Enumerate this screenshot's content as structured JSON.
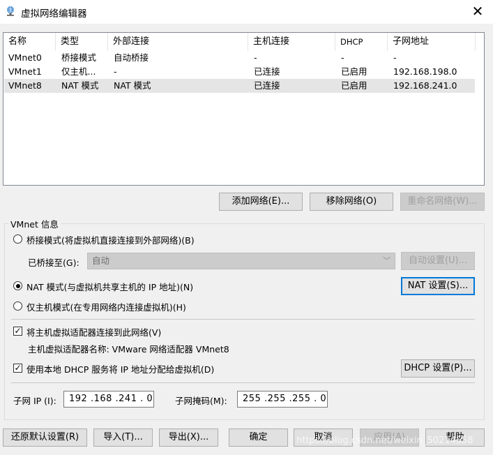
{
  "window": {
    "title": "虚拟网络编辑器",
    "close": "✕"
  },
  "table": {
    "headers": [
      "名称",
      "类型",
      "外部连接",
      "主机连接",
      "DHCP",
      "子网地址"
    ],
    "rows": [
      [
        "VMnet0",
        "桥接模式",
        "自动桥接",
        "-",
        "-",
        "-"
      ],
      [
        "VMnet1",
        "仅主机...",
        "-",
        "已连接",
        "已启用",
        "192.168.198.0"
      ],
      [
        "VMnet8",
        "NAT 模式",
        "NAT 模式",
        "已连接",
        "已启用",
        "192.168.241.0"
      ]
    ],
    "selected_row": 2
  },
  "net_buttons": {
    "add": "添加网络(E)...",
    "remove": "移除网络(O)",
    "rename": "重命名网络(W)..."
  },
  "info": {
    "group_title": "VMnet 信息",
    "bridged_label": "桥接模式(将虚拟机直接连接到外部网络)(B)",
    "bridged_to_label": "已桥接至(G):",
    "bridged_to_value": "自动",
    "auto_settings": "自动设置(U)...",
    "nat_label": "NAT 模式(与虚拟机共享主机的 IP 地址)(N)",
    "nat_settings": "NAT 设置(S)...",
    "hostonly_label": "仅主机模式(在专用网络内连接虚拟机)(H)",
    "connect_adapter_label": "将主机虚拟适配器连接到此网络(V)",
    "adapter_name": "主机虚拟适配器名称: VMware 网络适配器 VMnet8",
    "dhcp_label": "使用本地 DHCP 服务将 IP 地址分配给虚拟机(D)",
    "dhcp_settings": "DHCP 设置(P)...",
    "subnet_ip_label": "子网 IP (I):",
    "subnet_ip": "192 .168 .241 .  0",
    "subnet_mask_label": "子网掩码(M):",
    "subnet_mask": "255 .255 .255 .  0",
    "selected_mode": "nat",
    "connect_adapter_checked": true,
    "dhcp_checked": true,
    "check_mark": "✓"
  },
  "bottom_buttons": {
    "restore": "还原默认设置(R)",
    "import": "导入(T)...",
    "export": "导出(X)...",
    "ok": "确定",
    "cancel": "取消",
    "apply": "应用(A)",
    "help": "帮助"
  },
  "watermark": "https://blog.csdn.net/weixin_50214558"
}
